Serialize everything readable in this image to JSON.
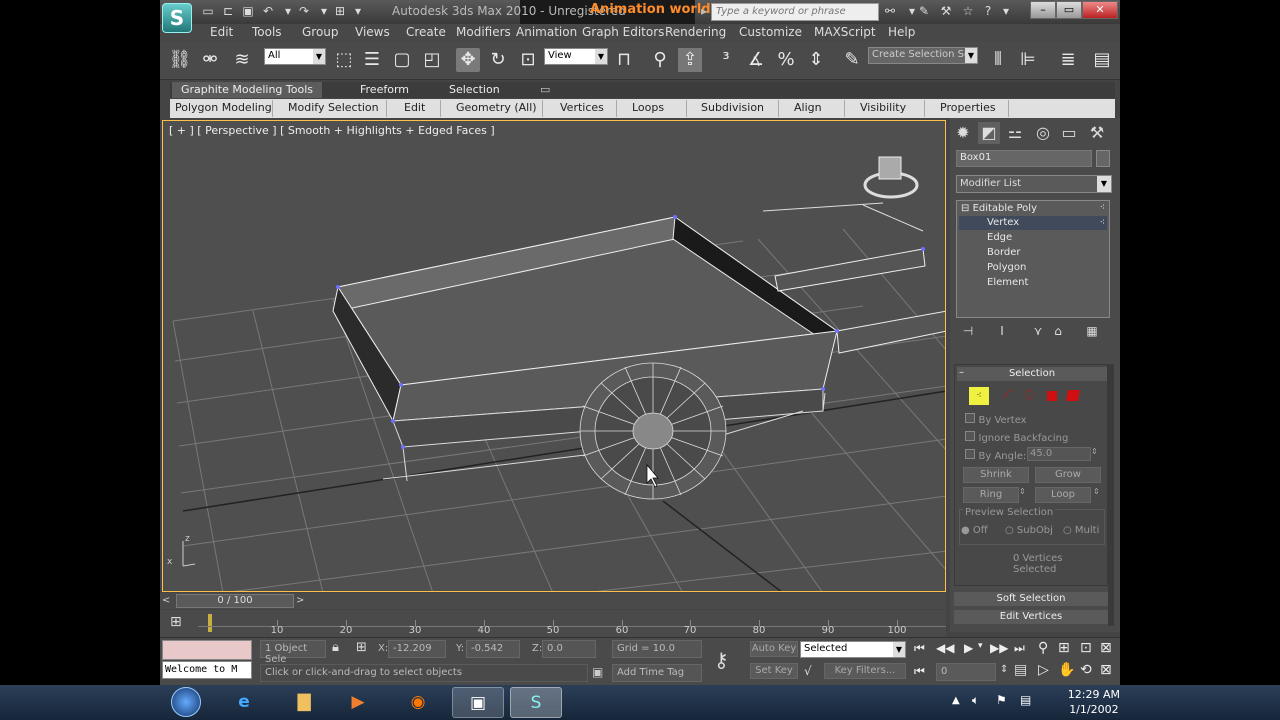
{
  "titlebar": {
    "app_title": "Autodesk 3ds Max 2010",
    "status": "Unregistered",
    "doc_title": "Animation world",
    "search_placeholder": "Type a keyword or phrase",
    "logo": "3ds-max-logo"
  },
  "menu": [
    "Edit",
    "Tools",
    "Group",
    "Views",
    "Create",
    "Modifiers",
    "Animation",
    "Graph Editors",
    "Rendering",
    "Customize",
    "MAXScript",
    "Help"
  ],
  "toolbar": {
    "filter_value": "All",
    "coord_value": "View",
    "selection_set_placeholder": "Create Selection Se"
  },
  "ribbon": {
    "tabs": [
      "Graphite Modeling Tools",
      "Freeform",
      "Selection"
    ],
    "subtabs": [
      "Polygon Modeling",
      "Modify Selection",
      "Edit",
      "Geometry (All)",
      "Vertices",
      "Loops",
      "Subdivision",
      "Align",
      "Visibility",
      "Properties"
    ]
  },
  "viewport": {
    "label": "[ + ] [ Perspective ] [ Smooth + Highlights + Edged Faces ]",
    "axis_z": "z",
    "axis_x": "x"
  },
  "command_panel": {
    "object_name": "Box01",
    "modifier_list": "Modifier List",
    "stack": {
      "root": "Editable Poly",
      "items": [
        "Vertex",
        "Edge",
        "Border",
        "Polygon",
        "Element"
      ],
      "selected": "Vertex"
    },
    "selection_rollout": {
      "title": "Selection",
      "by_vertex": "By Vertex",
      "ignore_backfacing": "Ignore Backfacing",
      "by_angle": "By Angle:",
      "angle_value": "45.0",
      "shrink": "Shrink",
      "grow": "Grow",
      "ring": "Ring",
      "loop": "Loop",
      "preview_title": "Preview Selection",
      "preview_options": [
        "Off",
        "SubObj",
        "Multi"
      ],
      "status": "0 Vertices Selected"
    },
    "soft_selection": "Soft Selection",
    "edit_vertices": "Edit Vertices"
  },
  "timeline": {
    "frame_label": "0 / 100",
    "ticks": [
      "10",
      "20",
      "30",
      "40",
      "50",
      "60",
      "70",
      "80",
      "90",
      "100"
    ]
  },
  "status": {
    "maxscript": "Welcome to M",
    "object_selected": "1 Object Sele",
    "x_label": "X:",
    "x_value": "-12.209",
    "y_label": "Y:",
    "y_value": "-0.542",
    "z_label": "Z:",
    "z_value": "0.0",
    "grid": "Grid = 10.0",
    "prompt": "Click or click-and-drag to select objects",
    "add_time_tag": "Add Time Tag",
    "auto_key": "Auto Key",
    "set_key": "Set Key",
    "key_mode": "Selected",
    "key_filters": "Key Filters...",
    "frame": "0"
  },
  "taskbar": {
    "apps": [
      "start-orb",
      "internet-explorer",
      "file-explorer",
      "media-player",
      "firefox",
      "video-app",
      "3ds-max"
    ],
    "time": "12:29 AM",
    "date": "1/1/2002"
  },
  "colors": {
    "accent_orange": "#ff8c2a",
    "viewport_border": "#ffbf4a",
    "vertex_yellow": "#f0f040",
    "selection_red": "#d01010"
  }
}
